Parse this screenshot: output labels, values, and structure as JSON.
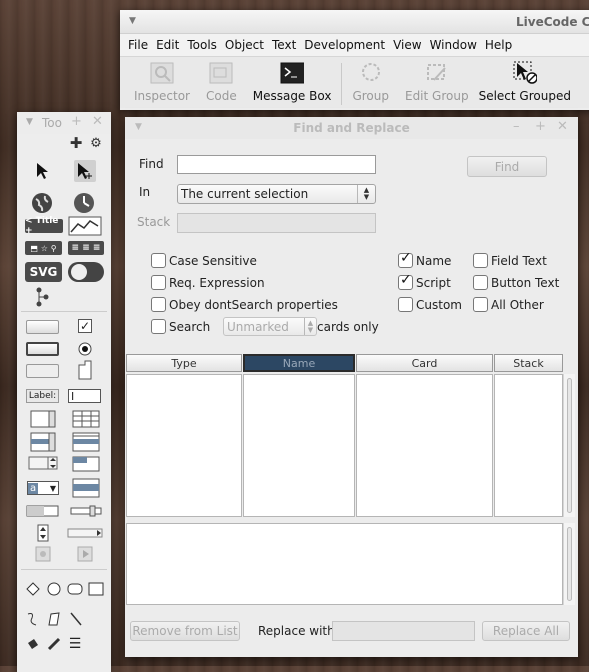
{
  "main": {
    "title": "LiveCode Co",
    "menus": [
      "File",
      "Edit",
      "Tools",
      "Object",
      "Text",
      "Development",
      "View",
      "Window",
      "Help"
    ],
    "toolbar": [
      {
        "label": "Inspector",
        "enabled": false
      },
      {
        "label": "Code",
        "enabled": false
      },
      {
        "label": "Message Box",
        "enabled": true
      },
      {
        "label": "Group",
        "enabled": false
      },
      {
        "label": "Edit Group",
        "enabled": false
      },
      {
        "label": "Select Grouped",
        "enabled": true
      }
    ]
  },
  "tools": {
    "title": "Too",
    "title_chip": "< Title +",
    "svg_label": "SVG",
    "label_field": "Label:",
    "combo_label": "a"
  },
  "dialog": {
    "title": "Find and Replace",
    "find_label": "Find",
    "find_value": "",
    "find_button": "Find",
    "in_label": "In",
    "in_value": "The current selection",
    "stack_label": "Stack",
    "stack_value": "",
    "options_left": [
      {
        "label": "Case Sensitive",
        "checked": false
      },
      {
        "label": "Req. Expression",
        "checked": false
      },
      {
        "label": "Obey dontSearch properties",
        "checked": false
      },
      {
        "label": "Search",
        "checked": false
      }
    ],
    "search_select_value": "Unmarked",
    "search_suffix": "cards only",
    "options_mid": [
      {
        "label": "Name",
        "checked": true
      },
      {
        "label": "Script",
        "checked": true
      },
      {
        "label": "Custom",
        "checked": false
      }
    ],
    "options_right": [
      {
        "label": "Field Text",
        "checked": false
      },
      {
        "label": "Button Text",
        "checked": false
      },
      {
        "label": "All Other",
        "checked": false
      }
    ],
    "columns": [
      "Type",
      "Name",
      "Card",
      "Stack"
    ],
    "selected_column": "Name",
    "remove_button": "Remove from List",
    "replace_label": "Replace with:",
    "replace_value": "",
    "replace_all_button": "Replace All"
  },
  "colors": {
    "accent": "#2c4763",
    "disabled_text": "#aaaaaa"
  }
}
